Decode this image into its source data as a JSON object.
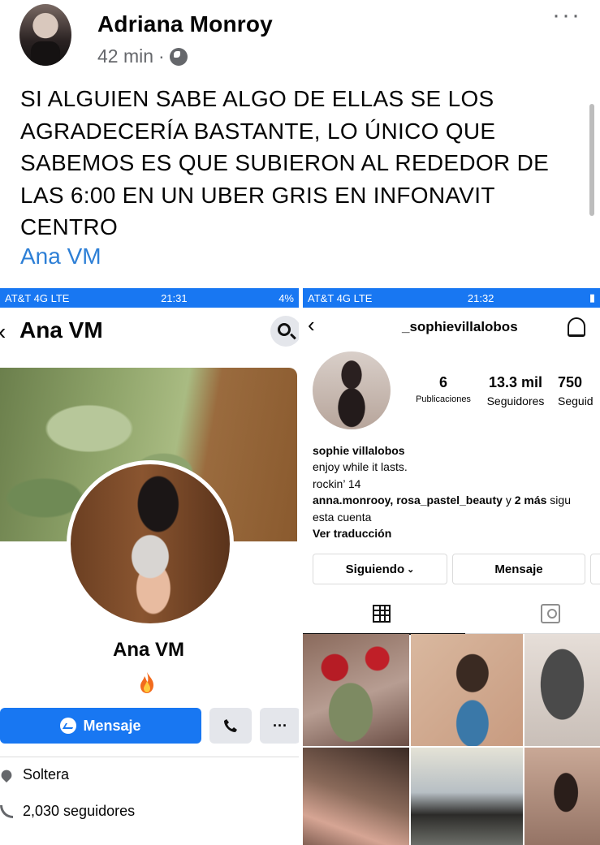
{
  "post": {
    "author": "Adriana Monroy",
    "time": "42 min",
    "separator": "·",
    "text": "SI ALGUIEN SABE ALGO DE ELLAS SE LOS AGRADECERÍA BASTANTE, LO ÚNICO QUE SABEMOS ES QUE SUBIERON AL REDEDOR DE LAS 6:00 EN UN UBER GRIS EN INFONAVIT CENTRO",
    "tag": "Ana VM",
    "more": "···"
  },
  "left_screenshot": {
    "status": {
      "carrier": "AT&T 4G  LTE",
      "time": "21:31",
      "battery": "4%"
    },
    "header_title": "Ana VM",
    "profile_name": "Ana VM",
    "message_button": "Mensaje",
    "more_button": "···",
    "info": {
      "relationship": "Soltera",
      "followers": "2,030 seguidores"
    }
  },
  "right_screenshot": {
    "status": {
      "carrier": "AT&T 4G  LTE",
      "time": "21:32"
    },
    "username": "_sophievillalobos",
    "stats": [
      {
        "n": "6",
        "l": "Publicaciones"
      },
      {
        "n": "13.3 mil",
        "l": "Seguidores"
      },
      {
        "n": "750",
        "l": "Seguid"
      }
    ],
    "bio": {
      "name": "sophie villalobos",
      "line1": "enjoy while it lasts.",
      "line2": "rockin’ 14",
      "followers_line_bold": "anna.monrooy, rosa_pastel_beauty",
      "followers_line_rest": " y ",
      "followers_line_bold2": "2 más",
      "followers_line_tail": " sigu",
      "followers_line2": "esta cuenta",
      "translate": "Ver traducción"
    },
    "buttons": {
      "following": "Siguiendo",
      "message": "Mensaje"
    }
  },
  "colors": {
    "fb_blue": "#1877f2",
    "link": "#2d7fd6",
    "meta_grey": "#65676b"
  }
}
